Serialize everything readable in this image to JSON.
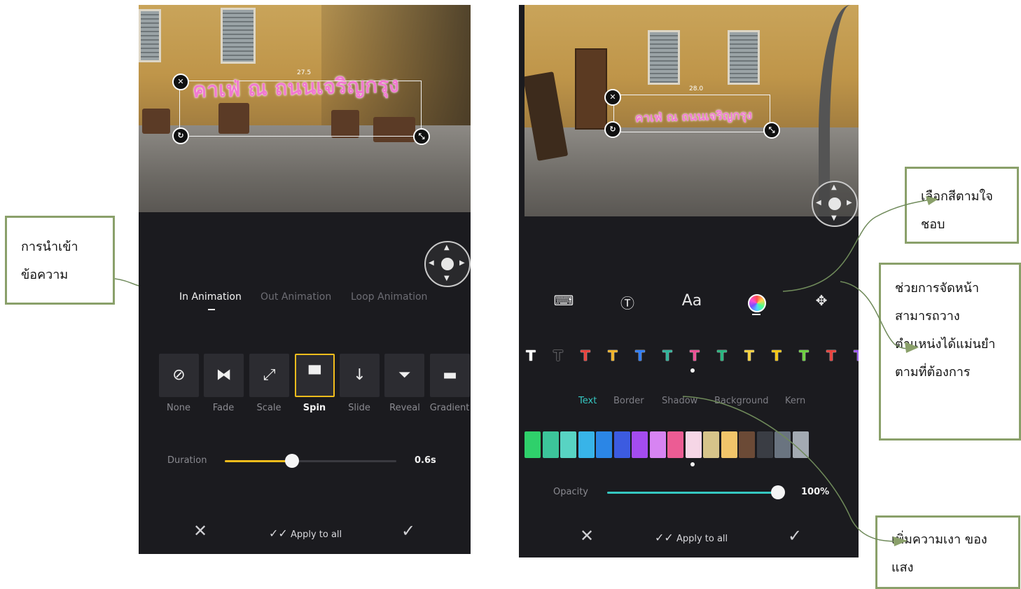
{
  "left_screen": {
    "photo_text": "คาเฟ่ ณ ถนนเจริญกรุง",
    "rotation_readout": "27.5",
    "tabs": [
      {
        "label": "In Animation",
        "active": true
      },
      {
        "label": "Out Animation",
        "active": false
      },
      {
        "label": "Loop Animation",
        "active": false
      }
    ],
    "animations": [
      {
        "label": "None",
        "icon": "none-icon",
        "selected": false
      },
      {
        "label": "Fade",
        "icon": "fade-icon",
        "selected": false
      },
      {
        "label": "Scale",
        "icon": "scale-icon",
        "selected": false
      },
      {
        "label": "Spin",
        "icon": "spin-icon",
        "selected": true
      },
      {
        "label": "Slide",
        "icon": "slide-icon",
        "selected": false
      },
      {
        "label": "Reveal",
        "icon": "reveal-icon",
        "selected": false
      },
      {
        "label": "Gradient",
        "icon": "gradient-icon",
        "selected": false
      }
    ],
    "duration_label": "Duration",
    "duration_value": "0.6s",
    "duration_fraction": 0.39,
    "accent": "#f3bd1c",
    "apply_label": "Apply to all"
  },
  "right_screen": {
    "photo_text": "คาเฟ่ ณ ถนนเจริญกรุง",
    "rotation_readout": "28.0",
    "tools": [
      {
        "icon": "keyboard-icon",
        "glyph": "⌨"
      },
      {
        "icon": "text-style-icon",
        "glyph": "Ⓣ"
      },
      {
        "icon": "font-icon",
        "glyph": "Aa"
      },
      {
        "icon": "color-wheel-icon",
        "glyph": ""
      },
      {
        "icon": "move-arrows-icon",
        "glyph": "✥"
      }
    ],
    "text_styles": [
      {
        "glyph": "T",
        "color": "#ffffff"
      },
      {
        "glyph": "T",
        "color": "#1b1b1f"
      },
      {
        "glyph": "T",
        "color": "#e8413c"
      },
      {
        "glyph": "T",
        "color": "#f0b429"
      },
      {
        "glyph": "T",
        "color": "#2f7cf6"
      },
      {
        "glyph": "T",
        "color": "#2fb39a"
      },
      {
        "glyph": "T",
        "color": "#ec4f93"
      },
      {
        "glyph": "T",
        "color": "#27b57e"
      },
      {
        "glyph": "T",
        "color": "#f4d03f"
      },
      {
        "glyph": "T",
        "color": "#f3c614"
      },
      {
        "glyph": "T",
        "color": "#6ccf3f"
      },
      {
        "glyph": "T",
        "color": "#e8413c"
      },
      {
        "glyph": "T",
        "color": "#9b59f6"
      }
    ],
    "sub_tabs": [
      {
        "label": "Text",
        "active": true
      },
      {
        "label": "Border",
        "active": false
      },
      {
        "label": "Shadow",
        "active": false
      },
      {
        "label": "Background",
        "active": false
      },
      {
        "label": "Kern",
        "active": false
      }
    ],
    "swatches": [
      "#2fd06b",
      "#3cc49a",
      "#58d3c3",
      "#38b4e8",
      "#2b86e6",
      "#3c5be0",
      "#a44cf0",
      "#d784f2",
      "#ec5c94",
      "#f6d6e6",
      "#d6c48a",
      "#f1c56a",
      "#6b4a36",
      "#3a3d44",
      "#6a7480",
      "#a3aab2"
    ],
    "opacity_label": "Opacity",
    "opacity_value": "100%",
    "opacity_fraction": 1.0,
    "accent": "#35c7c1",
    "apply_label": "Apply to all"
  },
  "callouts": {
    "import_text": "การนำเข้า\nข้อความ",
    "choose_color": "เลือกสีตามใจ\nชอบ",
    "layout_help": "ช่วยการจัดหน้า\nสามารถวาง\nตำแหน่งได้แม่นยำ\nตามที่ต้องการ",
    "shadow": "เพิ่มความเงา ของ\nแสง"
  }
}
